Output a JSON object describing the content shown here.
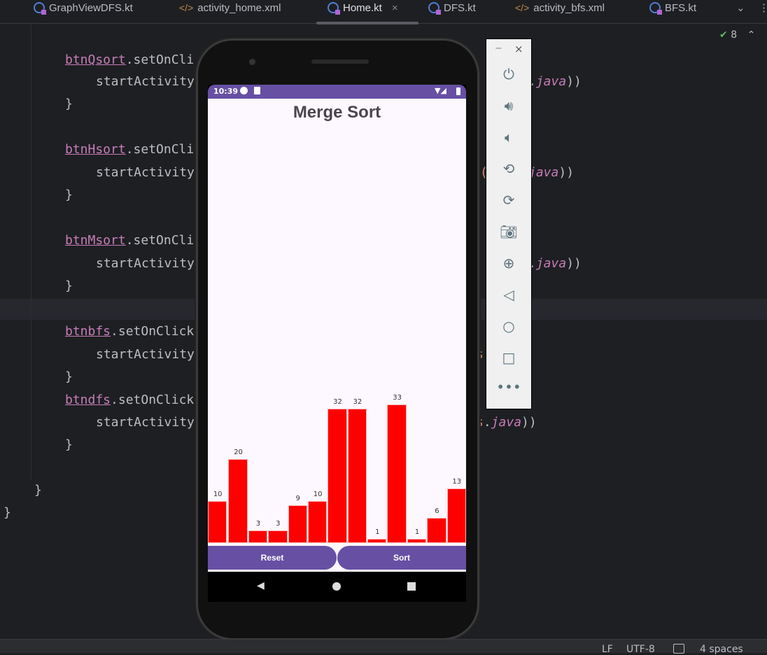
{
  "tabs": [
    {
      "label": "GraphViewDFS.kt",
      "type": "kotlin"
    },
    {
      "label": "activity_home.xml",
      "type": "xml"
    },
    {
      "label": "Home.kt",
      "type": "kotlin",
      "active": true
    },
    {
      "label": "DFS.kt",
      "type": "kotlin"
    },
    {
      "label": "activity_bfs.xml",
      "type": "xml"
    },
    {
      "label": "BFS.kt",
      "type": "kotlin"
    }
  ],
  "tab_close": "×",
  "inspections": {
    "count": "8"
  },
  "code": {
    "l0v": "btnQsort",
    "l0r": ".setOnCli",
    "l4v": "btnHsort",
    "l4r": ".setOnCli",
    "l8v": "btnMsort",
    "l8r": ".setOnCli",
    "l12v": "btnbfs",
    "l12r": ".setOnClick",
    "l15v": "btndfs",
    "l15r": ".setOnClick",
    "start": "startActivity",
    "brace": "}",
    "frag_java": "java",
    "frag_paren": "))",
    "frag_dot": ".",
    "frag_s": "s",
    "frag_open": "("
  },
  "status": {
    "line_sep": "LF",
    "encoding": "UTF-8",
    "indent": "4 spaces"
  },
  "phone": {
    "time": "10:39",
    "title": "Merge Sort",
    "reset": "Reset",
    "sort": "Sort",
    "bar_color": "#ff0000",
    "accent": "#6750a4"
  },
  "chart_data": {
    "type": "bar",
    "values": [
      10,
      20,
      3,
      3,
      9,
      10,
      32,
      32,
      1,
      33,
      1,
      6,
      13
    ],
    "labels": [
      "10",
      "20",
      "3",
      "3",
      "9",
      "10",
      "32",
      "32",
      "1",
      "33",
      "1",
      "6",
      "13"
    ]
  },
  "emulator": {
    "minimize": "−",
    "close": "×"
  }
}
